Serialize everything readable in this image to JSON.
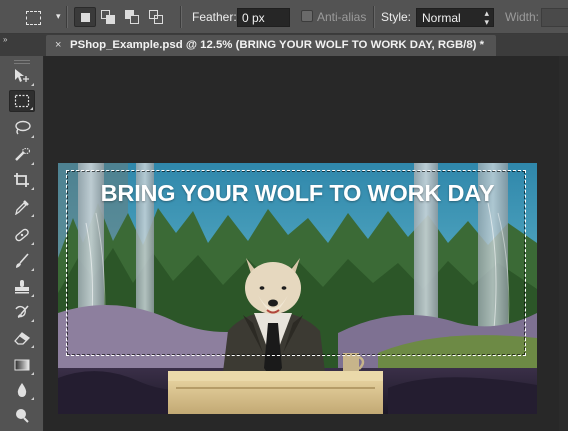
{
  "options_bar": {
    "tool_preset_icon": "rectangular-marquee-icon",
    "tool_preset_dropdown": "▾",
    "selection_modes": [
      {
        "name": "new-selection",
        "icon": "new-selection-icon",
        "active": true
      },
      {
        "name": "add-to-selection",
        "icon": "add-to-selection-icon",
        "active": false
      },
      {
        "name": "subtract-from-selection",
        "icon": "subtract-from-selection-icon",
        "active": false
      },
      {
        "name": "intersect-with-selection",
        "icon": "intersect-selection-icon",
        "active": false
      }
    ],
    "feather_label": "Feather:",
    "feather_value": "0 px",
    "antialias_label": "Anti-alias",
    "antialias_checked": false,
    "style_label": "Style:",
    "style_value": "Normal",
    "width_label": "Width:"
  },
  "tabs": {
    "collapse_glyph": "»",
    "document_tab": {
      "close_glyph": "×",
      "title": "PShop_Example.psd @ 12.5% (BRING YOUR WOLF TO WORK DAY, RGB/8) *"
    }
  },
  "toolbar": {
    "tools": [
      {
        "name": "move-tool",
        "icon": "move-icon",
        "active": false
      },
      {
        "name": "rectangular-marquee-tool",
        "icon": "rectangular-marquee-icon",
        "active": true
      },
      {
        "name": "lasso-tool",
        "icon": "lasso-icon",
        "active": false
      },
      {
        "name": "quick-selection-tool",
        "icon": "quick-selection-icon",
        "active": false
      },
      {
        "name": "crop-tool",
        "icon": "crop-icon",
        "active": false
      },
      {
        "name": "eyedropper-tool",
        "icon": "eyedropper-icon",
        "active": false
      },
      {
        "name": "spot-healing-tool",
        "icon": "bandage-icon",
        "active": false
      },
      {
        "name": "brush-tool",
        "icon": "brush-icon",
        "active": false
      },
      {
        "name": "clone-stamp-tool",
        "icon": "stamp-icon",
        "active": false
      },
      {
        "name": "history-brush-tool",
        "icon": "history-brush-icon",
        "active": false
      },
      {
        "name": "eraser-tool",
        "icon": "eraser-icon",
        "active": false
      },
      {
        "name": "gradient-tool",
        "icon": "gradient-icon",
        "active": false
      },
      {
        "name": "blur-tool",
        "icon": "blur-drop-icon",
        "active": false
      },
      {
        "name": "dodge-tool",
        "icon": "dodge-icon",
        "active": false
      }
    ]
  },
  "canvas": {
    "headline": "BRING YOUR WOLF TO WORK DAY",
    "colors": {
      "sky": "#3f97b8",
      "forest_dark": "#2f5a2c",
      "forest_mid": "#4b7a3a",
      "tree_trunk": "#b5c2c9",
      "hill_purple": "#8a7a98",
      "suit": "#3c3a33",
      "desk": "#d7c08c",
      "floor": "#2a2436",
      "wolf_fur": "#e6d8bf"
    }
  }
}
